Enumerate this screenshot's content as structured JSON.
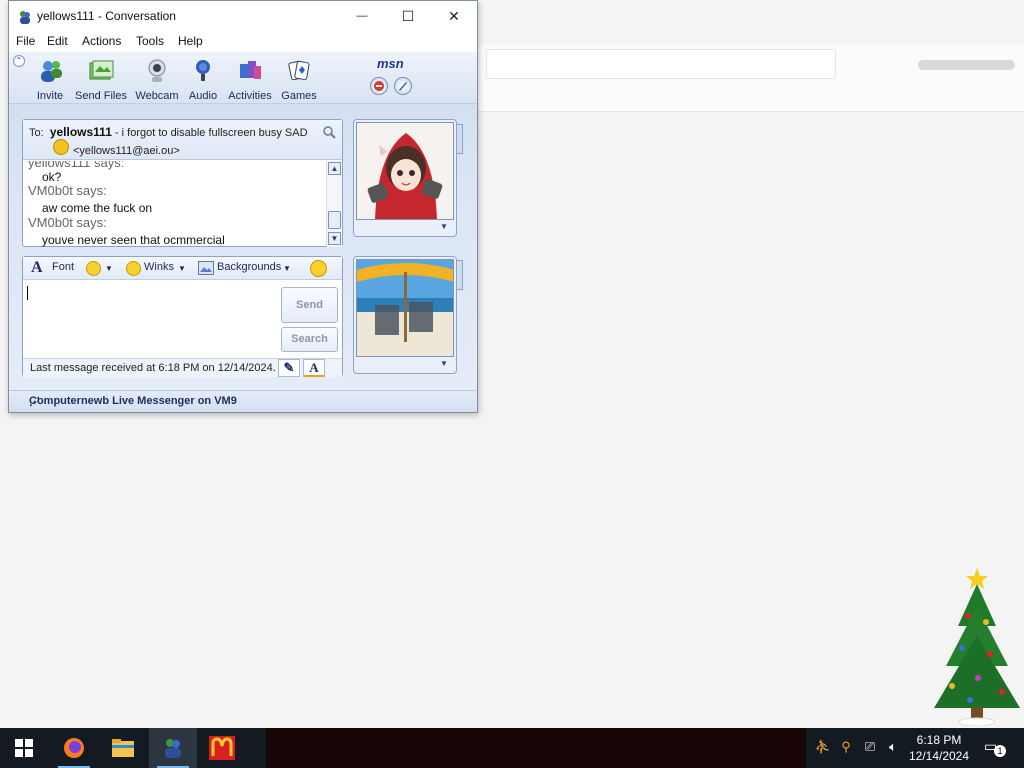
{
  "window": {
    "title": "yellows111 - Conversation",
    "minimize": "—",
    "maximize": "☐",
    "close": "✕"
  },
  "menu": [
    "File",
    "Edit",
    "Actions",
    "Tools",
    "Help"
  ],
  "toolbar": {
    "items": [
      {
        "label": "Invite",
        "icon": "invite-icon"
      },
      {
        "label": "Send Files",
        "icon": "send-files-icon"
      },
      {
        "label": "Webcam",
        "icon": "webcam-icon"
      },
      {
        "label": "Audio",
        "icon": "audio-icon"
      },
      {
        "label": "Activities",
        "icon": "activities-icon"
      },
      {
        "label": "Games",
        "icon": "games-icon"
      }
    ],
    "logo": "msn"
  },
  "contact": {
    "to_prefix": "To:",
    "name": "yellows111",
    "status_message": " - i forgot to disable fullscreen busy SAD",
    "email": "<yellows111@aei.ou>"
  },
  "messages": [
    {
      "type": "says",
      "text": "yellows111 says:"
    },
    {
      "type": "text",
      "text": "ok?"
    },
    {
      "type": "says",
      "text": "VM0b0t says:"
    },
    {
      "type": "text",
      "text": "aw come the fuck on"
    },
    {
      "type": "says",
      "text": "VM0b0t says:"
    },
    {
      "type": "text",
      "text": "youve never seen that ocmmercial"
    }
  ],
  "compose": {
    "font_label": "Font",
    "winks_label": "Winks",
    "backgrounds_label": "Backgrounds",
    "send_label": "Send",
    "search_label": "Search",
    "status": "Last message received at 6:18 PM on 12/14/2024."
  },
  "footer": {
    "text": "Computernewb Live Messenger on VM9"
  },
  "taskbar": {
    "time": "6:18 PM",
    "date": "12/14/2024",
    "notification_count": "1"
  },
  "colors": {
    "window_accent": "#d8e3f3",
    "taskbar": "#131a22",
    "msn_blue": "#1d3a8a"
  }
}
